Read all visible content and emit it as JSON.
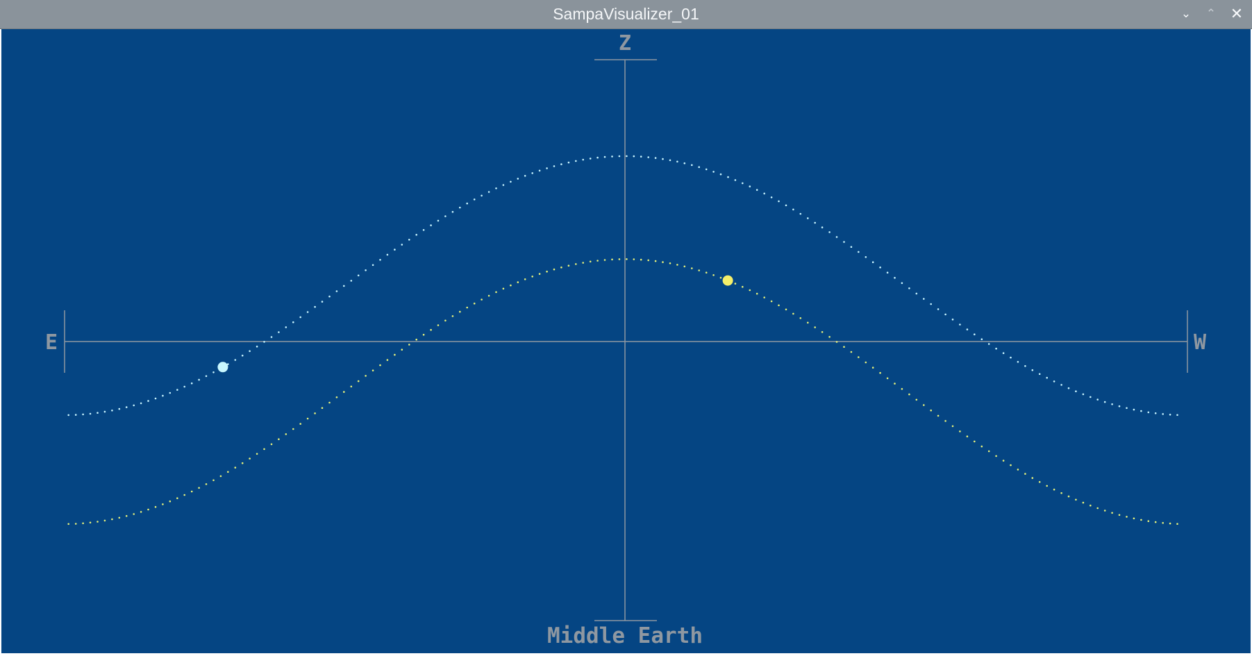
{
  "window": {
    "title": "SampaVisualizer_01",
    "controls": [
      "chevron-down-icon",
      "chevron-up-icon",
      "close-icon"
    ]
  },
  "colors": {
    "titlebar": "#8a939b",
    "background": "#054583",
    "axes": "#8f98a1",
    "upper_path": "#c9f5ff",
    "lower_path": "#e8f27a",
    "moon_marker": "#c9f8ff",
    "sun_marker": "#f5ef6a"
  },
  "labels": {
    "zenith": "Z",
    "east": "E",
    "west": "W",
    "footer": "Middle Earth"
  },
  "paths": {
    "upper": {
      "name": "upper path",
      "peak": 63,
      "low": -25,
      "marker_hour": -8.6
    },
    "lower": {
      "name": "lower path",
      "peak": 28,
      "low": -62,
      "marker_hour": 2.2
    }
  }
}
